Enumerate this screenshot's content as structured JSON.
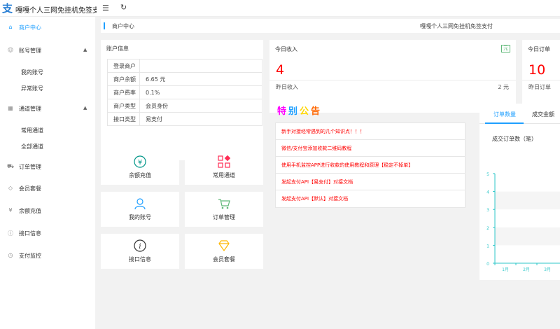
{
  "app": {
    "title": "嘎嘎个人三网免挂机免签支付",
    "logo_char": "支",
    "menu_icon": "menu-icon",
    "refresh_icon": "refresh-icon"
  },
  "sidebar": {
    "items": [
      {
        "label": "商户中心",
        "icon": "home-icon",
        "glyph": "⌂"
      },
      {
        "label": "账号管理",
        "icon": "user-icon",
        "glyph": "☺"
      },
      {
        "label": "通道管理",
        "icon": "grid-icon",
        "glyph": "▦"
      },
      {
        "label": "订单管理",
        "icon": "cart-icon",
        "glyph": "⛟"
      },
      {
        "label": "会员套餐",
        "icon": "diamond-icon",
        "glyph": "◇"
      },
      {
        "label": "余额充值",
        "icon": "yen-icon",
        "glyph": "¥"
      },
      {
        "label": "接口信息",
        "icon": "info-icon",
        "glyph": "ⓘ"
      },
      {
        "label": "支付监控",
        "icon": "speedometer-icon",
        "glyph": "◷"
      }
    ],
    "sub_account": [
      "我的账号",
      "异常账号"
    ],
    "sub_channel": [
      "常用通道",
      "全部通道"
    ]
  },
  "breadcrumb": {
    "current": "商户中心",
    "site_title": "嘎嘎个人三网免挂机免签支付"
  },
  "account": {
    "title": "账户信息",
    "rows": [
      {
        "k": "登录商户",
        "v": ""
      },
      {
        "k": "商户余额",
        "v": "6.65 元"
      },
      {
        "k": "商户费率",
        "v": "0.1%"
      },
      {
        "k": "商户类型",
        "v": "会员身份"
      },
      {
        "k": "接口类型",
        "v": "易支付"
      }
    ]
  },
  "tiles": [
    {
      "label": "余额充值",
      "icon": "yen-circle-icon",
      "glyph": "¥",
      "color": "#009688"
    },
    {
      "label": "常用通道",
      "icon": "apps-icon",
      "glyph": "",
      "color": "#ff2d55"
    },
    {
      "label": "我的账号",
      "icon": "user-icon",
      "glyph": "☺",
      "color": "#1e9fff"
    },
    {
      "label": "订单管理",
      "icon": "cart-icon",
      "glyph": "⛟",
      "color": "#5fb878"
    },
    {
      "label": "接口信息",
      "icon": "info-icon",
      "glyph": "ⓘ",
      "color": "#333333"
    },
    {
      "label": "会员套餐",
      "icon": "diamond-icon",
      "glyph": "◇",
      "color": "#ffb800"
    }
  ],
  "today_income": {
    "title": "今日收入",
    "badge": "元",
    "value": "4",
    "foot_label": "昨日收入",
    "foot_value": "2 元"
  },
  "today_orders": {
    "title": "今日订单",
    "value": "10",
    "foot_label": "昨日订单"
  },
  "notice": {
    "title_chars": [
      "特",
      "别",
      "公",
      "告"
    ],
    "title_colors": [
      "#ff00ff",
      "#1e9fff",
      "#ffd700",
      "#ff6600"
    ],
    "items": [
      "新手对接经常遇到的几个知识点！！！",
      "微信/支付宝添加收款二维码教程",
      "使用手机监控APP进行收款的使用教程和原理【稳定不掉单】",
      "发起支付API【易支付】对接文档",
      "发起支付API【默认】对接文档"
    ]
  },
  "stats_panel": {
    "tabs": [
      "订单数量",
      "成交金额"
    ],
    "chart_title": "成交订单数（笔）"
  },
  "chart_data": {
    "type": "line",
    "title": "成交订单数（笔）",
    "categories": [
      "1月",
      "2月",
      "3月"
    ],
    "y_ticks": [
      "0",
      "1",
      "2",
      "3",
      "4",
      "5"
    ],
    "ylim": [
      0,
      5
    ],
    "grid": true,
    "color": "#2ec7c9"
  }
}
